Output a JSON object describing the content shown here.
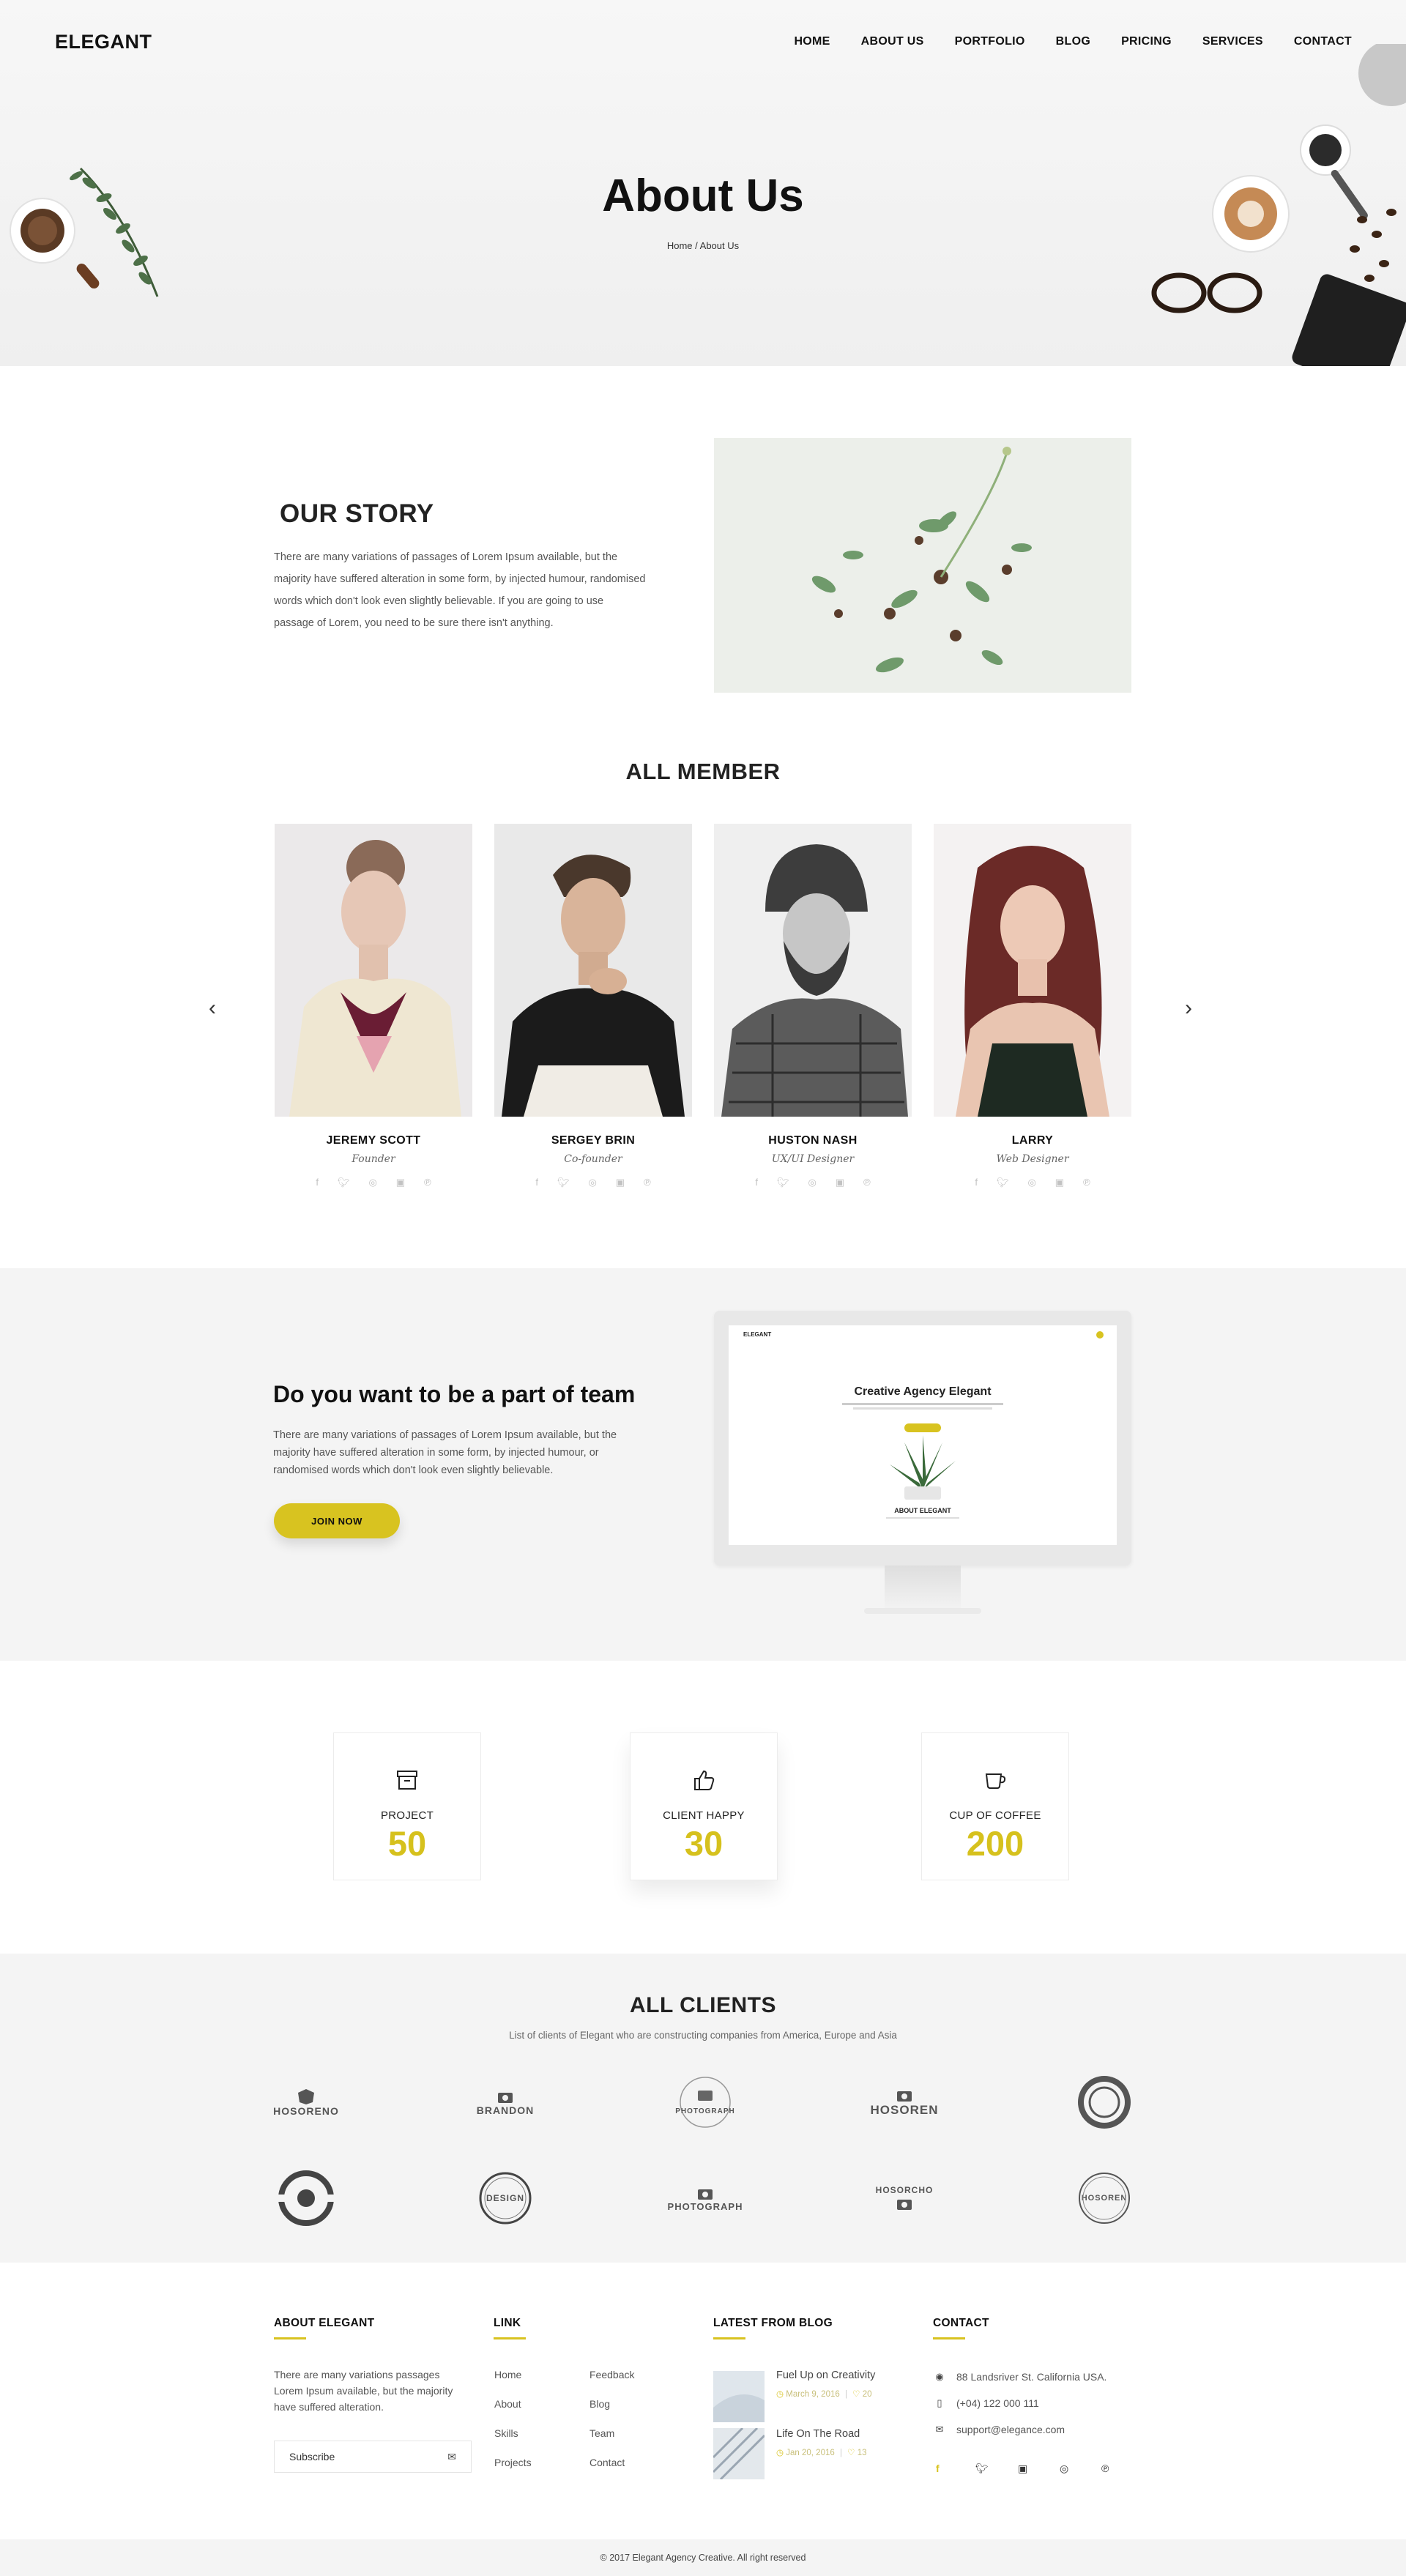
{
  "header": {
    "logo": "ELEGANT",
    "nav": [
      "HOME",
      "ABOUT US",
      "PORTFOLIO",
      "BLOG",
      "PRICING",
      "SERVICES",
      "CONTACT"
    ]
  },
  "hero": {
    "title": "About Us",
    "breadcrumb": "Home / About Us"
  },
  "story": {
    "title": "OUR STORY",
    "text": "There are many variations of passages of Lorem Ipsum available, but the majority have suffered alteration in some form, by injected humour, randomised words which don't look even slightly believable. If you are going to use passage of Lorem, you need to be sure there isn't anything."
  },
  "members": {
    "title": "ALL MEMBER",
    "list": [
      {
        "name": "JEREMY SCOTT",
        "role": "Founder"
      },
      {
        "name": "SERGEY BRIN",
        "role": "Co-founder"
      },
      {
        "name": "HUSTON NASH",
        "role": "UX/UI Designer"
      },
      {
        "name": "LARRY",
        "role": "Web Designer"
      }
    ],
    "social_icons": [
      "facebook-icon",
      "twitter-icon",
      "dribbble-icon",
      "instagram-icon",
      "pinterest-icon"
    ]
  },
  "join": {
    "title": "Do you want to be a part of team",
    "text": "There are many variations of passages of Lorem Ipsum available, but the majority have suffered alteration in some form, by injected humour, or randomised words which don't look even slightly believable.",
    "button": "JOIN NOW",
    "screen": {
      "logo": "ELEGANT",
      "title": "Creative Agency Elegant",
      "about": "ABOUT ELEGANT"
    }
  },
  "stats": [
    {
      "label": "PROJECT",
      "value": "50",
      "icon": "archive-box-icon"
    },
    {
      "label": "CLIENT HAPPY",
      "value": "30",
      "icon": "thumbs-up-icon"
    },
    {
      "label": "CUP OF COFFEE",
      "value": "200",
      "icon": "coffee-cup-icon"
    }
  ],
  "clients": {
    "title": "ALL CLIENTS",
    "subtitle": "List of clients of Elegant who are constructing companies from America, Europe and Asia",
    "logos": [
      "HOSORENO",
      "BRANDON",
      "PHOTOGRAPH",
      "HOSOREN",
      "",
      "",
      "DESIGN",
      "PHOTOGRAPH",
      "HOSORCHO",
      "HOSOREN"
    ]
  },
  "footer": {
    "about": {
      "title": "ABOUT ELEGANT",
      "text": "There are many variations passages Lorem Ipsum available, but the majority have suffered alteration.",
      "subscribe_placeholder": "Subscribe"
    },
    "links": {
      "title": "LINK",
      "col1": [
        "Home",
        "About",
        "Skills",
        "Projects"
      ],
      "col2": [
        "Feedback",
        "Blog",
        "Team",
        "Contact"
      ]
    },
    "blog": {
      "title": "LATEST FROM BLOG",
      "posts": [
        {
          "title": "Fuel Up on Creativity",
          "date": "March 9, 2016",
          "likes": "20"
        },
        {
          "title": "Life On The Road",
          "date": "Jan 20, 2016",
          "likes": "13"
        }
      ]
    },
    "contact": {
      "title": "CONTACT",
      "address": "88 Landsriver St. California USA.",
      "phone": "(+04) 122 000 111",
      "email": "support@elegance.com"
    },
    "copyright": "© 2017 Elegant Agency Creative. All right reserved"
  },
  "colors": {
    "accent": "#d8c320",
    "light_bg": "#f4f4f4"
  }
}
